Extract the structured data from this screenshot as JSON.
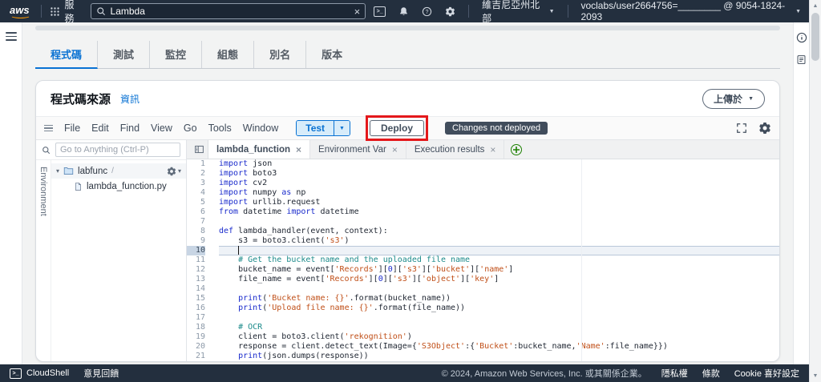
{
  "topbar": {
    "logo": "aws",
    "services": "服務",
    "search_value": "Lambda",
    "region": "維吉尼亞州北部",
    "account": "voclabs/user2664756=________ @ 9054-1824-2093"
  },
  "icons": {
    "caret_down": "▼",
    "caret_small": "▾",
    "caret_up": "▲",
    "close": "×",
    "plus": "+",
    "slash": "/",
    "terminal_prompt": ">_"
  },
  "function_tabs": [
    {
      "label": "程式碼",
      "active": true
    },
    {
      "label": "測試",
      "active": false
    },
    {
      "label": "監控",
      "active": false
    },
    {
      "label": "組態",
      "active": false
    },
    {
      "label": "別名",
      "active": false
    },
    {
      "label": "版本",
      "active": false
    }
  ],
  "code_source": {
    "title": "程式碼來源",
    "info": "資訊",
    "upload": "上傳於"
  },
  "ide": {
    "menus": [
      "File",
      "Edit",
      "Find",
      "View",
      "Go",
      "Tools",
      "Window"
    ],
    "test": "Test",
    "deploy": "Deploy",
    "badge": "Changes not deployed",
    "goto_placeholder": "Go to Anything (Ctrl-P)",
    "env": "Environment",
    "tree": {
      "folder": "labfunc",
      "file": "lambda_function.py"
    },
    "tabs": [
      {
        "label": "lambda_function",
        "active": true
      },
      {
        "label": "Environment Var",
        "active": false
      },
      {
        "label": "Execution results",
        "active": false
      }
    ],
    "active_line": 10,
    "code": [
      "import json",
      "import boto3",
      "import cv2",
      "import numpy as np",
      "import urllib.request",
      "from datetime import datetime",
      "",
      "def lambda_handler(event, context):",
      "    s3 = boto3.client('s3')",
      "    ",
      "    # Get the bucket name and the uploaded file name",
      "    bucket_name = event['Records'][0]['s3']['bucket']['name']",
      "    file_name = event['Records'][0]['s3']['object']['key']",
      "",
      "    print('Bucket name: {}'.format(bucket_name))",
      "    print('Upload file name: {}'.format(file_name))",
      "",
      "    # OCR",
      "    client = boto3.client('rekognition')",
      "    response = client.detect_text(Image={'S3Object':{'Bucket':bucket_name,'Name':file_name}})",
      "    print(json.dumps(response))",
      ""
    ]
  },
  "footer": {
    "cloudshell": "CloudShell",
    "feedback": "意見回饋",
    "copyright": "© 2024, Amazon Web Services, Inc. 或其關係企業。",
    "privacy": "隱私權",
    "terms": "條款",
    "cookie": "Cookie 喜好設定"
  },
  "colors": {
    "accent": "#0972d3",
    "topbar_bg": "#232f3e",
    "annotation_red": "#e4181b",
    "badge_bg": "#414d5c",
    "syntax_keyword": "#1a2bcc",
    "syntax_string": "#c04f18",
    "syntax_comment": "#1b8a8a"
  }
}
